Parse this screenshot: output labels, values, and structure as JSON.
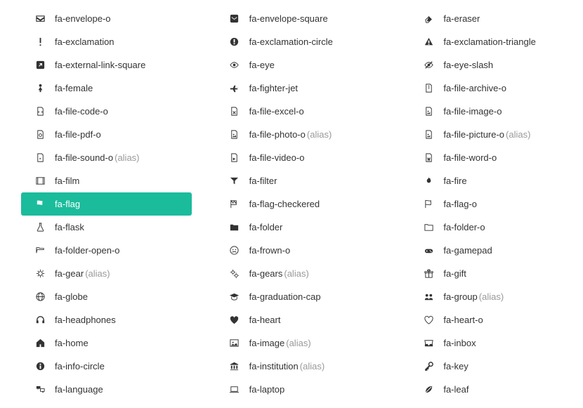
{
  "alias_suffix": "(alias)",
  "selected_id": "fa-flag",
  "columns": [
    [
      {
        "id": "fa-envelope-o",
        "label": "fa-envelope-o",
        "icon": "envelope-o"
      },
      {
        "id": "fa-exclamation",
        "label": "fa-exclamation",
        "icon": "exclamation"
      },
      {
        "id": "fa-external-link-square",
        "label": "fa-external-link-square",
        "icon": "external-link-square"
      },
      {
        "id": "fa-female",
        "label": "fa-female",
        "icon": "female"
      },
      {
        "id": "fa-file-code-o",
        "label": "fa-file-code-o",
        "icon": "file-code-o"
      },
      {
        "id": "fa-file-pdf-o",
        "label": "fa-file-pdf-o",
        "icon": "file-pdf-o"
      },
      {
        "id": "fa-file-sound-o",
        "label": "fa-file-sound-o",
        "icon": "file-sound-o",
        "alias": true
      },
      {
        "id": "fa-film",
        "label": "fa-film",
        "icon": "film"
      },
      {
        "id": "fa-flag",
        "label": "fa-flag",
        "icon": "flag"
      },
      {
        "id": "fa-flask",
        "label": "fa-flask",
        "icon": "flask"
      },
      {
        "id": "fa-folder-open-o",
        "label": "fa-folder-open-o",
        "icon": "folder-open-o"
      },
      {
        "id": "fa-gear",
        "label": "fa-gear",
        "icon": "gear",
        "alias": true
      },
      {
        "id": "fa-globe",
        "label": "fa-globe",
        "icon": "globe"
      },
      {
        "id": "fa-headphones",
        "label": "fa-headphones",
        "icon": "headphones"
      },
      {
        "id": "fa-home",
        "label": "fa-home",
        "icon": "home"
      },
      {
        "id": "fa-info-circle",
        "label": "fa-info-circle",
        "icon": "info-circle"
      },
      {
        "id": "fa-language",
        "label": "fa-language",
        "icon": "language"
      }
    ],
    [
      {
        "id": "fa-envelope-square",
        "label": "fa-envelope-square",
        "icon": "envelope-square"
      },
      {
        "id": "fa-exclamation-circle",
        "label": "fa-exclamation-circle",
        "icon": "exclamation-circle"
      },
      {
        "id": "fa-eye",
        "label": "fa-eye",
        "icon": "eye"
      },
      {
        "id": "fa-fighter-jet",
        "label": "fa-fighter-jet",
        "icon": "fighter-jet"
      },
      {
        "id": "fa-file-excel-o",
        "label": "fa-file-excel-o",
        "icon": "file-excel-o"
      },
      {
        "id": "fa-file-photo-o",
        "label": "fa-file-photo-o",
        "icon": "file-photo-o",
        "alias": true
      },
      {
        "id": "fa-file-video-o",
        "label": "fa-file-video-o",
        "icon": "file-video-o"
      },
      {
        "id": "fa-filter",
        "label": "fa-filter",
        "icon": "filter"
      },
      {
        "id": "fa-flag-checkered",
        "label": "fa-flag-checkered",
        "icon": "flag-checkered"
      },
      {
        "id": "fa-folder",
        "label": "fa-folder",
        "icon": "folder"
      },
      {
        "id": "fa-frown-o",
        "label": "fa-frown-o",
        "icon": "frown-o"
      },
      {
        "id": "fa-gears",
        "label": "fa-gears",
        "icon": "gears",
        "alias": true
      },
      {
        "id": "fa-graduation-cap",
        "label": "fa-graduation-cap",
        "icon": "graduation-cap"
      },
      {
        "id": "fa-heart",
        "label": "fa-heart",
        "icon": "heart"
      },
      {
        "id": "fa-image",
        "label": "fa-image",
        "icon": "image",
        "alias": true
      },
      {
        "id": "fa-institution",
        "label": "fa-institution",
        "icon": "institution",
        "alias": true
      },
      {
        "id": "fa-laptop",
        "label": "fa-laptop",
        "icon": "laptop"
      }
    ],
    [
      {
        "id": "fa-eraser",
        "label": "fa-eraser",
        "icon": "eraser"
      },
      {
        "id": "fa-exclamation-triangle",
        "label": "fa-exclamation-triangle",
        "icon": "exclamation-triangle"
      },
      {
        "id": "fa-eye-slash",
        "label": "fa-eye-slash",
        "icon": "eye-slash"
      },
      {
        "id": "fa-file-archive-o",
        "label": "fa-file-archive-o",
        "icon": "file-archive-o"
      },
      {
        "id": "fa-file-image-o",
        "label": "fa-file-image-o",
        "icon": "file-image-o"
      },
      {
        "id": "fa-file-picture-o",
        "label": "fa-file-picture-o",
        "icon": "file-picture-o",
        "alias": true
      },
      {
        "id": "fa-file-word-o",
        "label": "fa-file-word-o",
        "icon": "file-word-o"
      },
      {
        "id": "fa-fire",
        "label": "fa-fire",
        "icon": "fire"
      },
      {
        "id": "fa-flag-o",
        "label": "fa-flag-o",
        "icon": "flag-o"
      },
      {
        "id": "fa-folder-o",
        "label": "fa-folder-o",
        "icon": "folder-o"
      },
      {
        "id": "fa-gamepad",
        "label": "fa-gamepad",
        "icon": "gamepad"
      },
      {
        "id": "fa-gift",
        "label": "fa-gift",
        "icon": "gift"
      },
      {
        "id": "fa-group",
        "label": "fa-group",
        "icon": "group",
        "alias": true
      },
      {
        "id": "fa-heart-o",
        "label": "fa-heart-o",
        "icon": "heart-o"
      },
      {
        "id": "fa-inbox",
        "label": "fa-inbox",
        "icon": "inbox"
      },
      {
        "id": "fa-key",
        "label": "fa-key",
        "icon": "key"
      },
      {
        "id": "fa-leaf",
        "label": "fa-leaf",
        "icon": "leaf"
      }
    ]
  ]
}
